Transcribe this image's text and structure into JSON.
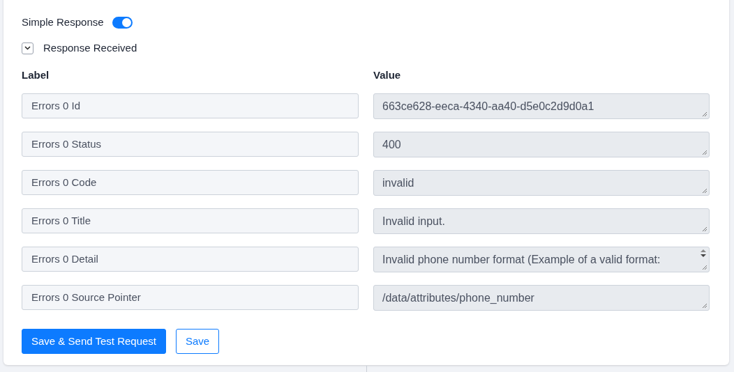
{
  "simple_response": {
    "label": "Simple Response",
    "on": true
  },
  "section": {
    "title": "Response Received",
    "expanded": true
  },
  "columns": [
    "Label",
    "Value"
  ],
  "rows": [
    {
      "label": "Errors 0 Id",
      "value": "663ce628-eeca-4340-aa40-d5e0c2d9d0a1",
      "kind": "single"
    },
    {
      "label": "Errors 0 Status",
      "value": "400",
      "kind": "single"
    },
    {
      "label": "Errors 0 Code",
      "value": "invalid",
      "kind": "single"
    },
    {
      "label": "Errors 0 Title",
      "value": "Invalid input.",
      "kind": "single"
    },
    {
      "label": "Errors 0 Detail",
      "value": "Invalid phone number format (Example of a valid format:",
      "kind": "overflow"
    },
    {
      "label": "Errors 0 Source Pointer",
      "value": "/data/attributes/phone_number",
      "kind": "single"
    }
  ],
  "buttons": [
    {
      "label": "Save & Send Test Request",
      "kind": "primary"
    },
    {
      "label": "Save",
      "kind": "outline"
    }
  ]
}
